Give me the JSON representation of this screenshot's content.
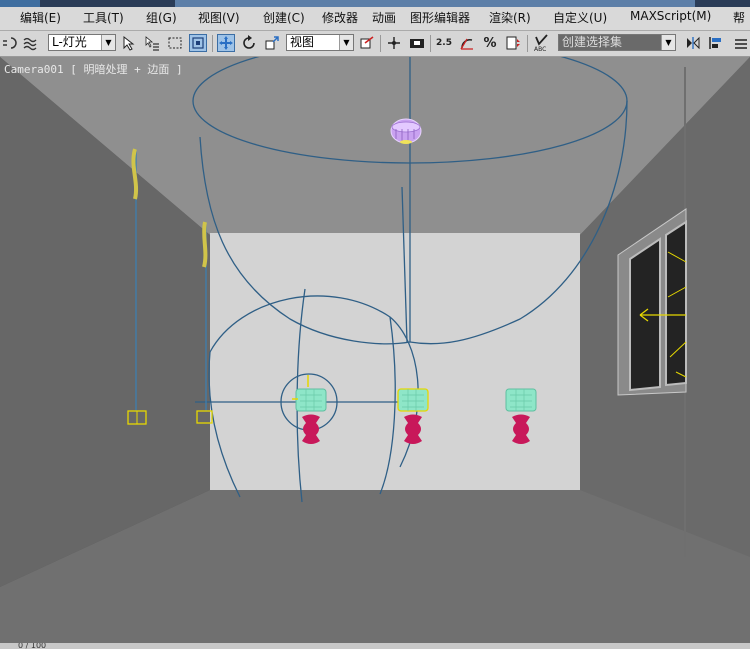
{
  "menu": {
    "items": [
      "编辑(E)",
      "工具(T)",
      "组(G)",
      "视图(V)",
      "创建(C)",
      "修改器",
      "动画",
      "图形编辑器",
      "渲染(R)",
      "自定义(U)",
      "MAXScript(M)",
      "帮"
    ]
  },
  "toolbar": {
    "selection_filter": "L-灯光",
    "reference_coord": "视图",
    "angle_snap_label": "2.5",
    "named_selection_placeholder": "创建选择集",
    "icons": [
      "unlink-icon",
      "bind-spacewarp-icon",
      "selection-filter",
      "select-object-icon",
      "select-by-name-icon",
      "rectangular-selection-icon",
      "window-crossing-icon",
      "move-icon",
      "rotate-icon",
      "scale-icon",
      "reference-coord-dropdown",
      "pivot-icon",
      "select-manipulate-icon",
      "keyboard-shortcut-icon",
      "snap-toggle-icon",
      "angle-snap-icon",
      "percent-snap-icon",
      "spinner-snap-icon",
      "edit-named-selection-icon",
      "named-selection-dropdown",
      "mirror-icon",
      "align-icon"
    ]
  },
  "viewport": {
    "label": "Camera001 [ 明暗处理 + 边面 ]"
  },
  "status": {
    "frame_counter": "0 / 100"
  },
  "colors": {
    "wireframe": "#2f5f86",
    "light_yellow": "#e6d800",
    "lamp_shade": "#8ee6c8",
    "lamp_base": "#c8185a",
    "chandelier": "#c9a2f0",
    "back_wall": "#cfcfcf",
    "selection_highlight": "#9fc3e7"
  }
}
